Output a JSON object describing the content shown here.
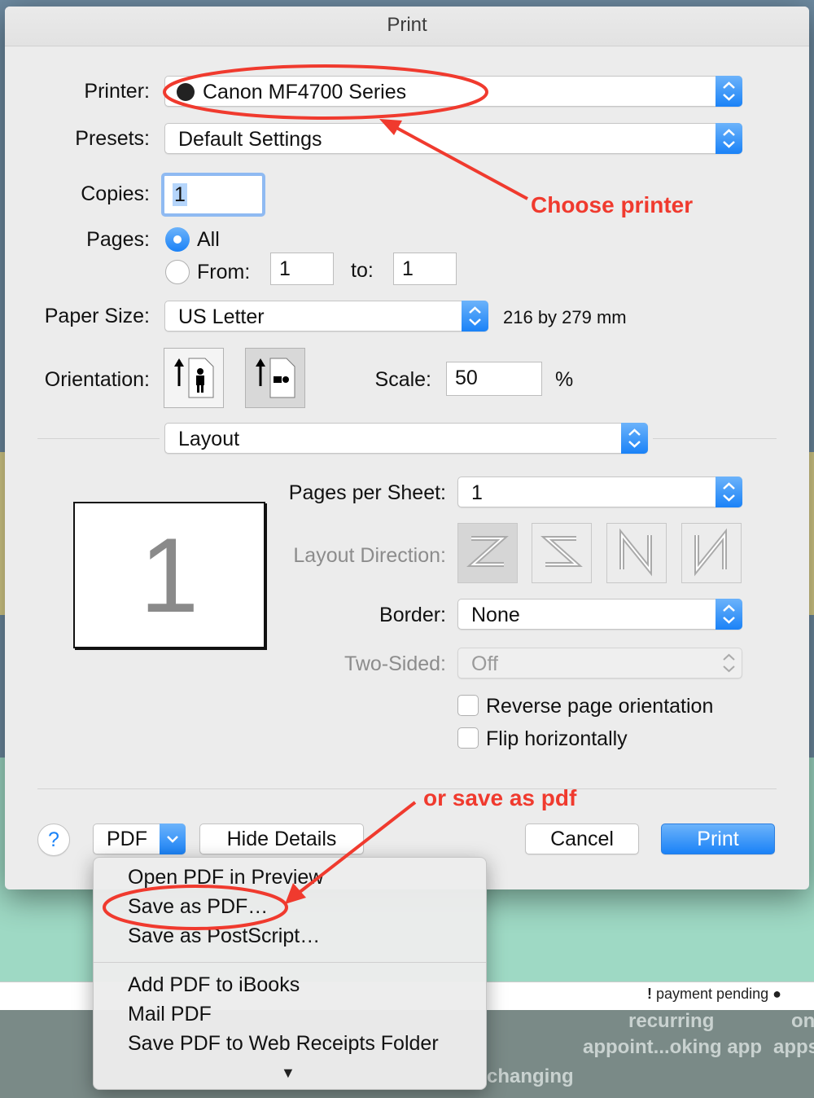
{
  "dialog": {
    "title": "Print",
    "printer": {
      "label": "Printer:",
      "value": "Canon MF4700 Series"
    },
    "presets": {
      "label": "Presets:",
      "value": "Default Settings"
    },
    "copies": {
      "label": "Copies:",
      "value": "1"
    },
    "pages": {
      "label": "Pages:",
      "all_label": "All",
      "from_label": "From:",
      "from_value": "1",
      "to_label": "to:",
      "to_value": "1"
    },
    "paper_size": {
      "label": "Paper Size:",
      "value": "US Letter",
      "dimensions": "216 by 279 mm"
    },
    "orientation": {
      "label": "Orientation:"
    },
    "scale": {
      "label": "Scale:",
      "value": "50",
      "unit": "%"
    },
    "section": {
      "value": "Layout"
    },
    "preview": {
      "page_number": "1"
    },
    "pages_per_sheet": {
      "label": "Pages per Sheet:",
      "value": "1"
    },
    "layout_direction": {
      "label": "Layout Direction:"
    },
    "border": {
      "label": "Border:",
      "value": "None"
    },
    "two_sided": {
      "label": "Two-Sided:",
      "value": "Off"
    },
    "reverse_label": "Reverse page orientation",
    "flip_label": "Flip horizontally",
    "buttons": {
      "help": "?",
      "pdf": "PDF",
      "hide_details": "Hide Details",
      "cancel": "Cancel",
      "print": "Print"
    }
  },
  "pdf_menu": {
    "items_group1": [
      "Open PDF in Preview",
      "Save as PDF…",
      "Save as PostScript…"
    ],
    "items_group2": [
      "Add PDF to iBooks",
      "Mail PDF",
      "Save PDF to Web Receipts Folder"
    ],
    "more_arrow": "▼"
  },
  "annotations": {
    "choose_printer": "Choose printer",
    "save_pdf": "or save as pdf"
  },
  "background": {
    "payment_pending": "payment pending",
    "recurring": "recurring",
    "appoint": "appoint...oking app",
    "apps": "apps",
    "on": "on",
    "changing": "changing"
  },
  "colors": {
    "accent": "#1a82f7",
    "annotation": "#f03a2e"
  }
}
